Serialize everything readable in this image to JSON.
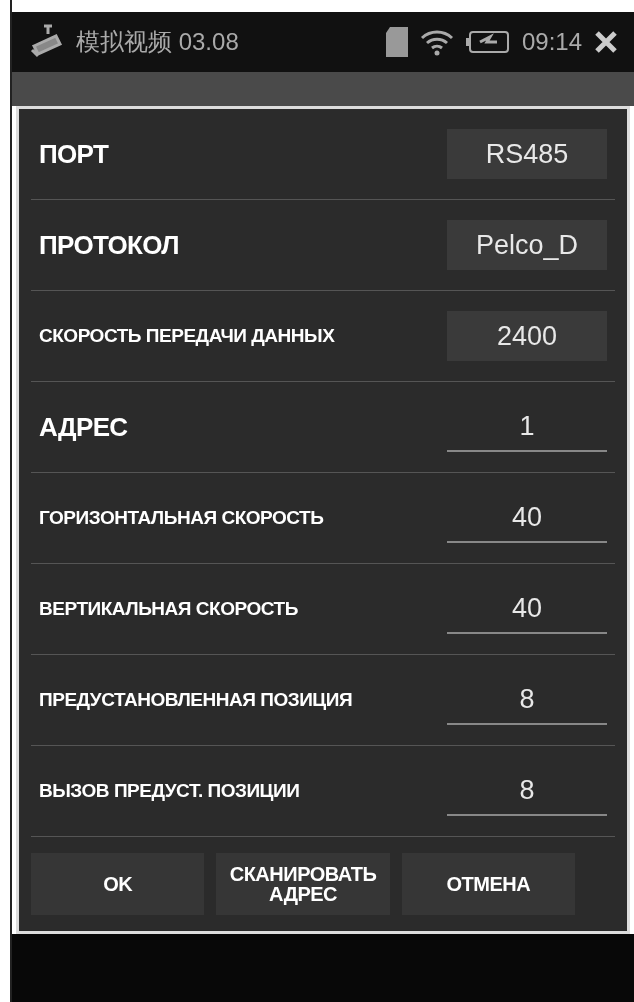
{
  "status_bar": {
    "title": "模拟视频 03.08",
    "time": "09:14"
  },
  "dialog": {
    "fields": [
      {
        "label": "ПОРТ",
        "value": "RS485",
        "kind": "select"
      },
      {
        "label": "ПРОТОКОЛ",
        "value": "Pelco_D",
        "kind": "select"
      },
      {
        "label": "СКОРОСТЬ ПЕРЕДАЧИ ДАННЫХ",
        "value": "2400",
        "kind": "select"
      },
      {
        "label": "АДРЕС",
        "value": "1",
        "kind": "input"
      },
      {
        "label": "ГОРИЗОНТАЛЬНАЯ СКОРОСТЬ",
        "value": "40",
        "kind": "input"
      },
      {
        "label": "ВЕРТИКАЛЬНАЯ СКОРОСТЬ",
        "value": "40",
        "kind": "input"
      },
      {
        "label": "ПРЕДУСТАНОВЛЕННАЯ ПОЗИЦИЯ",
        "value": "8",
        "kind": "input"
      },
      {
        "label": "ВЫЗОВ ПРЕДУСТ. ПОЗИЦИИ",
        "value": "8",
        "kind": "input"
      }
    ],
    "buttons": [
      "OK",
      "СКАНИРОВАТЬ АДРЕС",
      "ОТМЕНА"
    ]
  }
}
